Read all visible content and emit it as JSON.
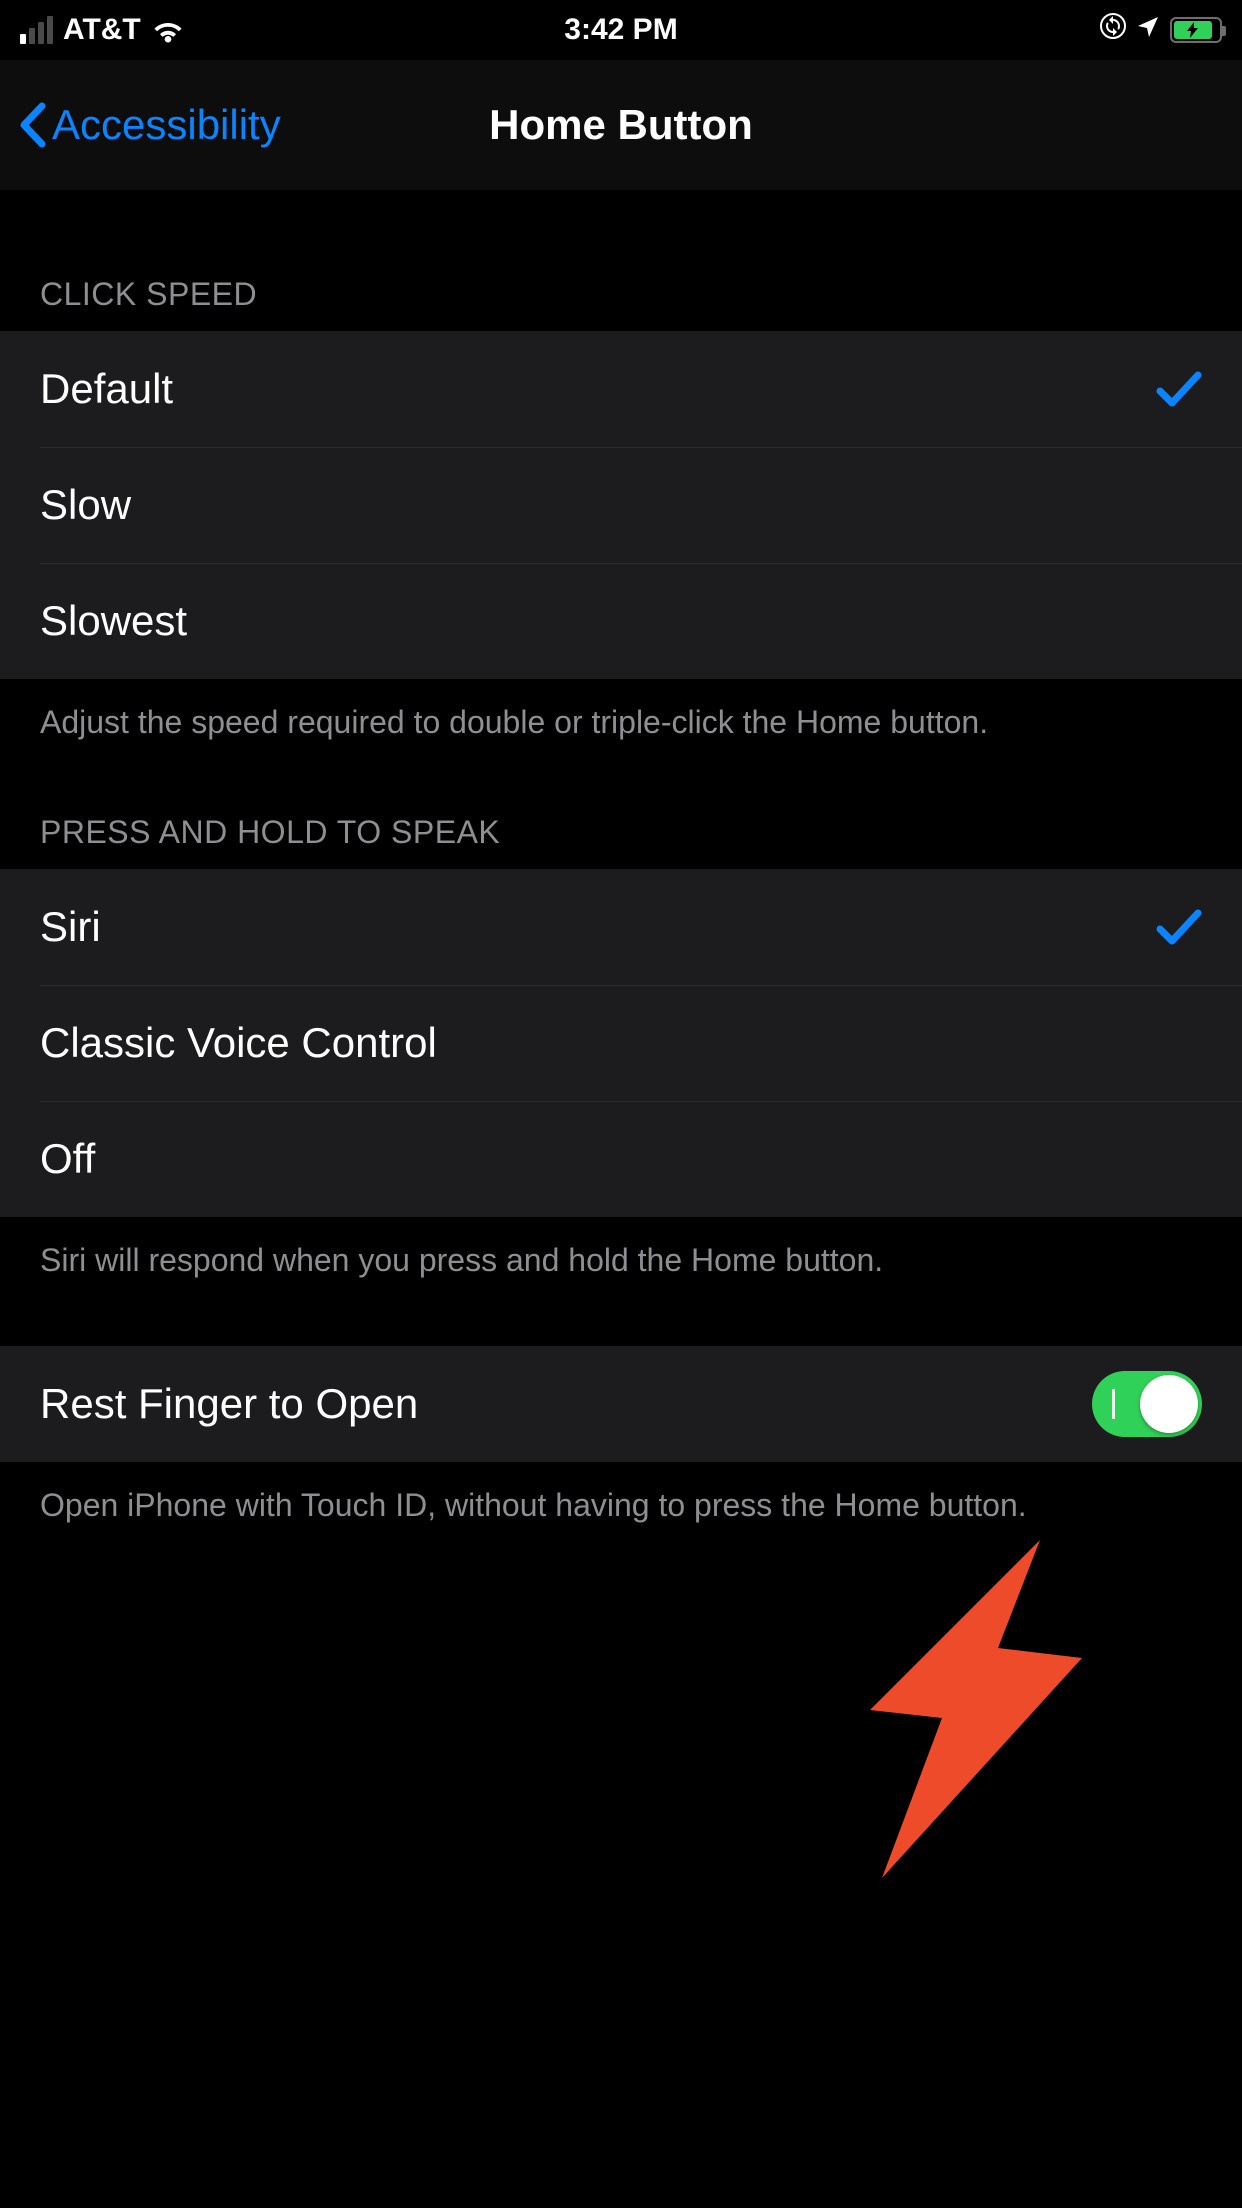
{
  "status_bar": {
    "carrier": "AT&T",
    "time": "3:42 PM"
  },
  "nav": {
    "back_label": "Accessibility",
    "title": "Home Button"
  },
  "sections": {
    "click_speed": {
      "header": "CLICK SPEED",
      "options": [
        "Default",
        "Slow",
        "Slowest"
      ],
      "selected_index": 0,
      "footer": "Adjust the speed required to double or triple-click the Home button."
    },
    "press_hold": {
      "header": "PRESS AND HOLD TO SPEAK",
      "options": [
        "Siri",
        "Classic Voice Control",
        "Off"
      ],
      "selected_index": 0,
      "footer": "Siri will respond when you press and hold the Home button."
    },
    "rest_finger": {
      "label": "Rest Finger to Open",
      "on": true,
      "footer": "Open iPhone with Touch ID, without having to press the Home button."
    }
  },
  "colors": {
    "accent_blue": "#0a84ff",
    "toggle_green": "#30d158",
    "annotation_red": "#ee4b2b"
  }
}
